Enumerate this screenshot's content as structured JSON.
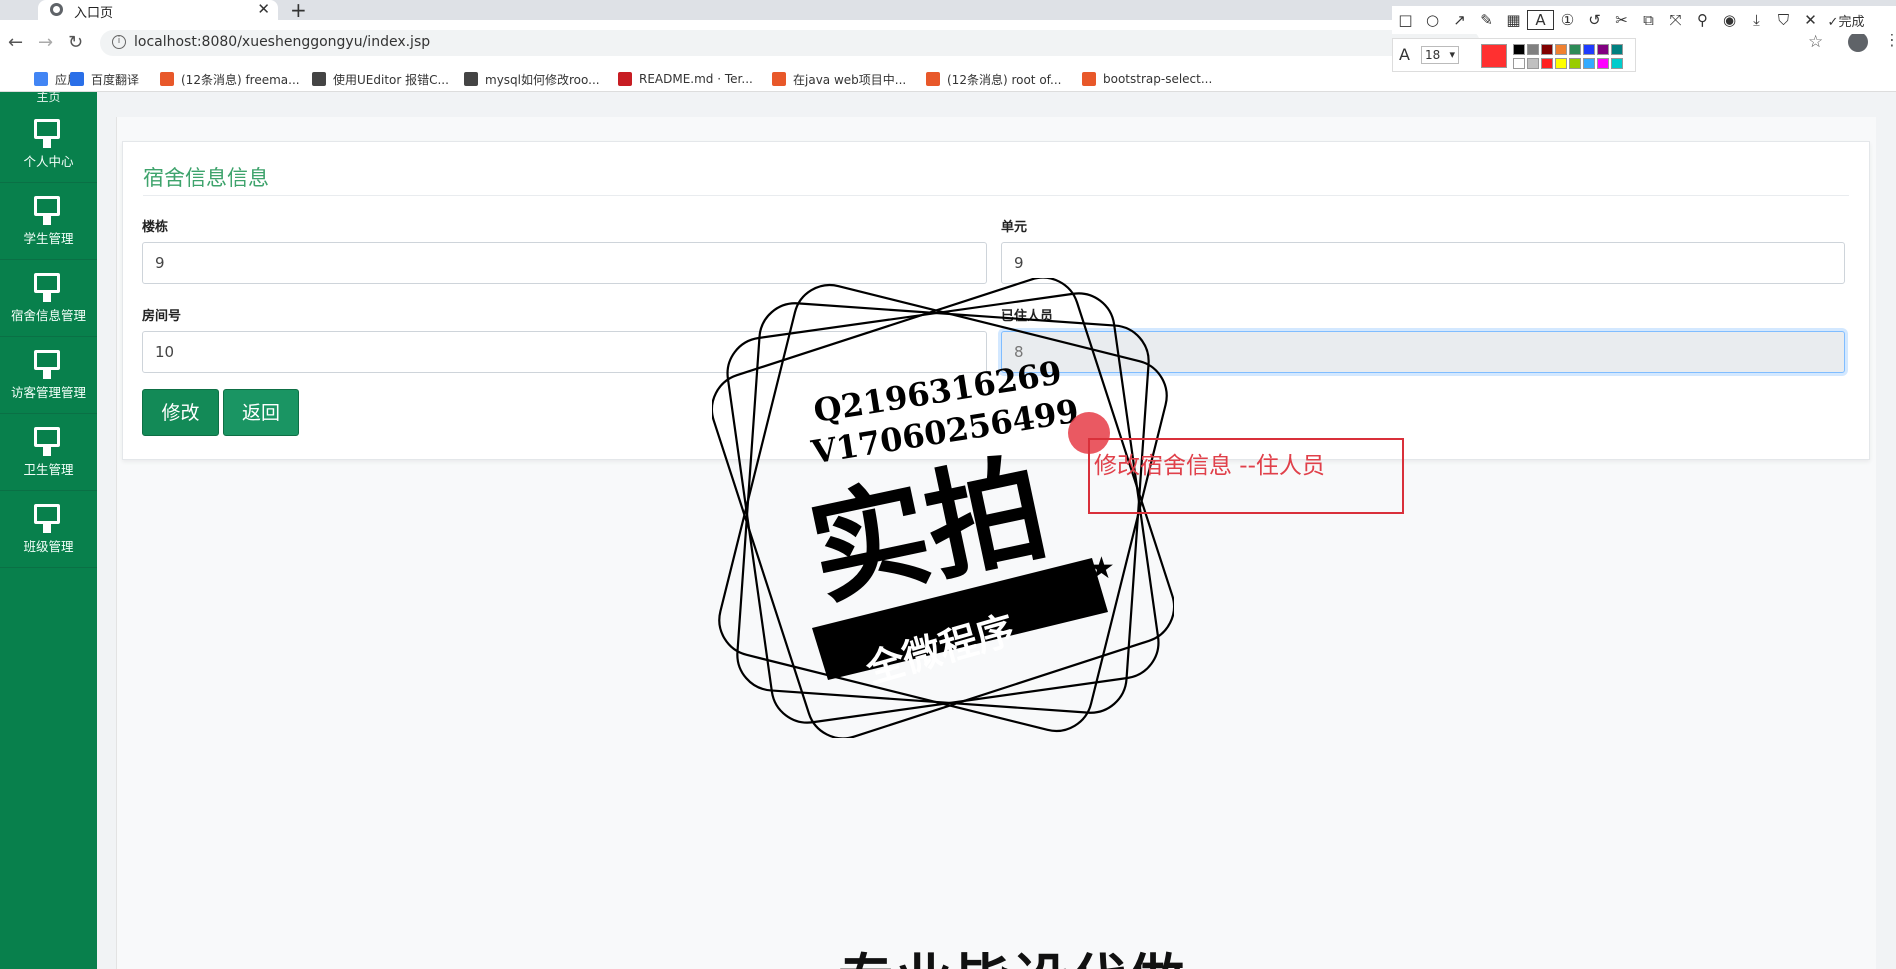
{
  "browser": {
    "tab_title": "入口页",
    "url": "localhost:8080/xueshenggongyu/index.jsp",
    "bookmarks": [
      {
        "label": "应用",
        "color": "#4285f4"
      },
      {
        "label": "百度翻译",
        "color": "#2a6fe8"
      },
      {
        "label": "(12条消息) freema...",
        "color": "#e8582a"
      },
      {
        "label": "使用UEditor 报错C...",
        "color": "#444444"
      },
      {
        "label": "mysql如何修改roo...",
        "color": "#444444"
      },
      {
        "label": "README.md · Ter...",
        "color": "#c71d23"
      },
      {
        "label": "在java web项目中...",
        "color": "#e8582a"
      },
      {
        "label": "(12条消息) root of...",
        "color": "#e8582a"
      },
      {
        "label": "bootstrap-select...",
        "color": "#e8582a"
      }
    ]
  },
  "snip": {
    "done_label": "完成",
    "font_size": "18",
    "current_color": "#ff3030",
    "palette": [
      "#000000",
      "#808080",
      "#800000",
      "#f08030",
      "#2e8b57",
      "#1e3cff",
      "#800080",
      "#008080",
      "#ffffff",
      "#c0c0c0",
      "#ff2020",
      "#ffff00",
      "#99cc00",
      "#33aaff",
      "#ff00ff",
      "#00cccc"
    ]
  },
  "sidebar": {
    "top_partial": "主页",
    "items": [
      {
        "label": "个人中心"
      },
      {
        "label": "学生管理"
      },
      {
        "label": "宿舍信息管理"
      },
      {
        "label": "访客管理管理"
      },
      {
        "label": "卫生管理"
      },
      {
        "label": "班级管理"
      }
    ]
  },
  "form": {
    "title": "宿舍信息信息",
    "fields": {
      "building": {
        "label": "楼栋",
        "value": "9"
      },
      "unit": {
        "label": "单元",
        "value": "9"
      },
      "room": {
        "label": "房间号",
        "value": "10"
      },
      "occupants": {
        "label": "已住人员",
        "value": "8"
      }
    },
    "buttons": {
      "edit": "修改",
      "back": "返回"
    }
  },
  "annotation": {
    "text": "修改宿舍信息 --住人员"
  },
  "watermark": {
    "line1": "Q2196316269",
    "line2": "V17060256499",
    "main": "实拍",
    "ribbon": "全微程序"
  },
  "bottom_text": "专业毕设代做"
}
